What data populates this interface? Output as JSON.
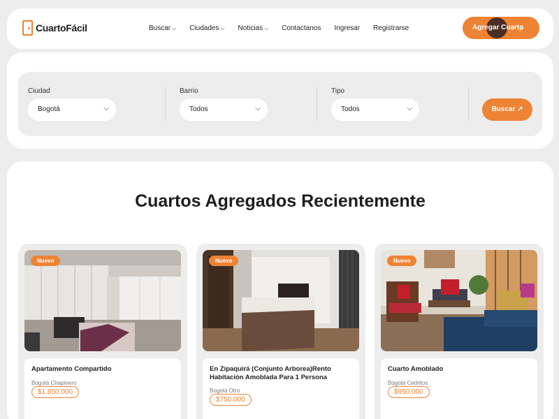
{
  "brand": {
    "name": "CuartoFácil"
  },
  "nav": {
    "items": [
      {
        "label": "Buscar",
        "dropdown": true
      },
      {
        "label": "Ciudades",
        "dropdown": true
      },
      {
        "label": "Noticias",
        "dropdown": true
      },
      {
        "label": "Contactanos",
        "dropdown": false
      },
      {
        "label": "Ingresar",
        "dropdown": false
      },
      {
        "label": "Registrarse",
        "dropdown": false
      }
    ],
    "cta_label": "Agregar Cuarto"
  },
  "search": {
    "city": {
      "label": "Ciudad",
      "value": "Bogotá"
    },
    "neighborhood": {
      "label": "Barrio",
      "value": "Todos"
    },
    "type": {
      "label": "Tipo",
      "value": "Todos"
    },
    "button_label": "Buscar ↗"
  },
  "recent": {
    "title": "Cuartos Agregados Recientemente",
    "listings": [
      {
        "badge": "Nuevo",
        "title": "Apartamento Compartido",
        "location": "Bogotá Chapinero",
        "price": "$1.850.000"
      },
      {
        "badge": "Nuevo",
        "title": "En Zipaquirá (Conjunto Arborea)Rento Habitación Amoblada Para 1 Persona",
        "location": "Bogotá Otro",
        "price": "$750.000"
      },
      {
        "badge": "Nuevo",
        "title": "Cuarto Amoblado",
        "location": "Bogotá Cedritos",
        "price": "$950.000"
      }
    ]
  },
  "colors": {
    "accent": "#ee8333",
    "background": "#ededed",
    "text": "#1e1e1e"
  },
  "icons": {
    "logo": "door-icon",
    "dropdown": "chevron-down-icon",
    "cta": "arrow-up-right-icon"
  }
}
